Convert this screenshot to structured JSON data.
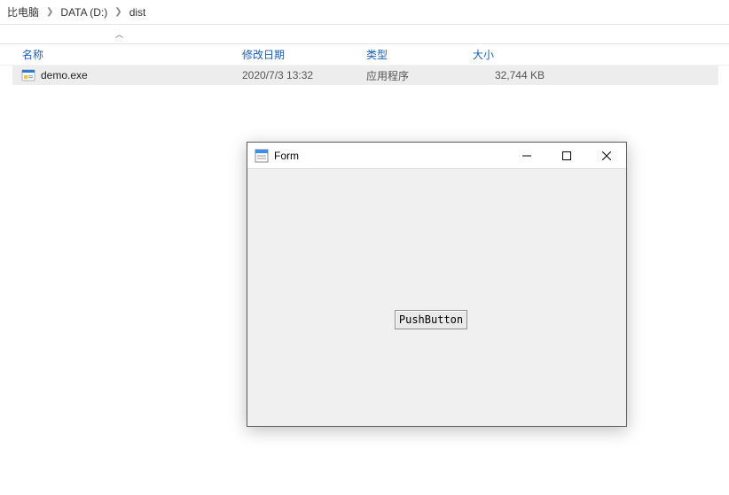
{
  "breadcrumb": {
    "items": [
      "比电脑",
      "DATA (D:)",
      "dist"
    ]
  },
  "columns": {
    "name": "名称",
    "date": "修改日期",
    "type": "类型",
    "size": "大小"
  },
  "files": [
    {
      "name": "demo.exe",
      "date": "2020/7/3 13:32",
      "type": "应用程序",
      "size": "32,744 KB"
    }
  ],
  "app_window": {
    "title": "Form",
    "button_label": "PushButton"
  }
}
